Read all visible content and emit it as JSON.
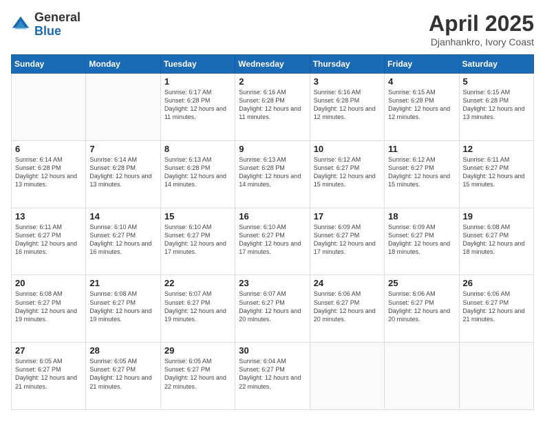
{
  "header": {
    "logo_general": "General",
    "logo_blue": "Blue",
    "title": "April 2025",
    "subtitle": "Djanhankro, Ivory Coast"
  },
  "weekdays": [
    "Sunday",
    "Monday",
    "Tuesday",
    "Wednesday",
    "Thursday",
    "Friday",
    "Saturday"
  ],
  "weeks": [
    [
      {
        "day": "",
        "info": ""
      },
      {
        "day": "",
        "info": ""
      },
      {
        "day": "1",
        "info": "Sunrise: 6:17 AM\nSunset: 6:28 PM\nDaylight: 12 hours and 11 minutes."
      },
      {
        "day": "2",
        "info": "Sunrise: 6:16 AM\nSunset: 6:28 PM\nDaylight: 12 hours and 11 minutes."
      },
      {
        "day": "3",
        "info": "Sunrise: 6:16 AM\nSunset: 6:28 PM\nDaylight: 12 hours and 12 minutes."
      },
      {
        "day": "4",
        "info": "Sunrise: 6:15 AM\nSunset: 6:28 PM\nDaylight: 12 hours and 12 minutes."
      },
      {
        "day": "5",
        "info": "Sunrise: 6:15 AM\nSunset: 6:28 PM\nDaylight: 12 hours and 13 minutes."
      }
    ],
    [
      {
        "day": "6",
        "info": "Sunrise: 6:14 AM\nSunset: 6:28 PM\nDaylight: 12 hours and 13 minutes."
      },
      {
        "day": "7",
        "info": "Sunrise: 6:14 AM\nSunset: 6:28 PM\nDaylight: 12 hours and 13 minutes."
      },
      {
        "day": "8",
        "info": "Sunrise: 6:13 AM\nSunset: 6:28 PM\nDaylight: 12 hours and 14 minutes."
      },
      {
        "day": "9",
        "info": "Sunrise: 6:13 AM\nSunset: 6:28 PM\nDaylight: 12 hours and 14 minutes."
      },
      {
        "day": "10",
        "info": "Sunrise: 6:12 AM\nSunset: 6:27 PM\nDaylight: 12 hours and 15 minutes."
      },
      {
        "day": "11",
        "info": "Sunrise: 6:12 AM\nSunset: 6:27 PM\nDaylight: 12 hours and 15 minutes."
      },
      {
        "day": "12",
        "info": "Sunrise: 6:11 AM\nSunset: 6:27 PM\nDaylight: 12 hours and 15 minutes."
      }
    ],
    [
      {
        "day": "13",
        "info": "Sunrise: 6:11 AM\nSunset: 6:27 PM\nDaylight: 12 hours and 16 minutes."
      },
      {
        "day": "14",
        "info": "Sunrise: 6:10 AM\nSunset: 6:27 PM\nDaylight: 12 hours and 16 minutes."
      },
      {
        "day": "15",
        "info": "Sunrise: 6:10 AM\nSunset: 6:27 PM\nDaylight: 12 hours and 17 minutes."
      },
      {
        "day": "16",
        "info": "Sunrise: 6:10 AM\nSunset: 6:27 PM\nDaylight: 12 hours and 17 minutes."
      },
      {
        "day": "17",
        "info": "Sunrise: 6:09 AM\nSunset: 6:27 PM\nDaylight: 12 hours and 17 minutes."
      },
      {
        "day": "18",
        "info": "Sunrise: 6:09 AM\nSunset: 6:27 PM\nDaylight: 12 hours and 18 minutes."
      },
      {
        "day": "19",
        "info": "Sunrise: 6:08 AM\nSunset: 6:27 PM\nDaylight: 12 hours and 18 minutes."
      }
    ],
    [
      {
        "day": "20",
        "info": "Sunrise: 6:08 AM\nSunset: 6:27 PM\nDaylight: 12 hours and 19 minutes."
      },
      {
        "day": "21",
        "info": "Sunrise: 6:08 AM\nSunset: 6:27 PM\nDaylight: 12 hours and 19 minutes."
      },
      {
        "day": "22",
        "info": "Sunrise: 6:07 AM\nSunset: 6:27 PM\nDaylight: 12 hours and 19 minutes."
      },
      {
        "day": "23",
        "info": "Sunrise: 6:07 AM\nSunset: 6:27 PM\nDaylight: 12 hours and 20 minutes."
      },
      {
        "day": "24",
        "info": "Sunrise: 6:06 AM\nSunset: 6:27 PM\nDaylight: 12 hours and 20 minutes."
      },
      {
        "day": "25",
        "info": "Sunrise: 6:06 AM\nSunset: 6:27 PM\nDaylight: 12 hours and 20 minutes."
      },
      {
        "day": "26",
        "info": "Sunrise: 6:06 AM\nSunset: 6:27 PM\nDaylight: 12 hours and 21 minutes."
      }
    ],
    [
      {
        "day": "27",
        "info": "Sunrise: 6:05 AM\nSunset: 6:27 PM\nDaylight: 12 hours and 21 minutes."
      },
      {
        "day": "28",
        "info": "Sunrise: 6:05 AM\nSunset: 6:27 PM\nDaylight: 12 hours and 21 minutes."
      },
      {
        "day": "29",
        "info": "Sunrise: 6:05 AM\nSunset: 6:27 PM\nDaylight: 12 hours and 22 minutes."
      },
      {
        "day": "30",
        "info": "Sunrise: 6:04 AM\nSunset: 6:27 PM\nDaylight: 12 hours and 22 minutes."
      },
      {
        "day": "",
        "info": ""
      },
      {
        "day": "",
        "info": ""
      },
      {
        "day": "",
        "info": ""
      }
    ]
  ]
}
